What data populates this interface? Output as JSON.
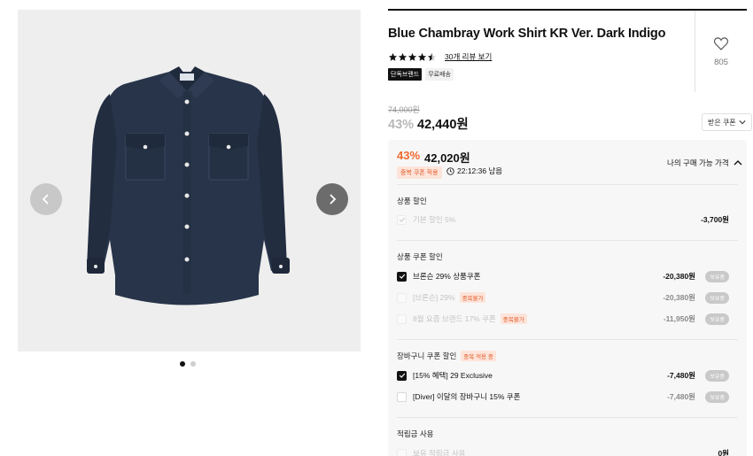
{
  "gallery": {
    "prev_icon": "chevron-left-icon",
    "next_icon": "chevron-right-icon",
    "current_slide": 1,
    "total_slides": 2
  },
  "product": {
    "title": "Blue Chambray Work Shirt KR Ver. Dark Indigo",
    "rating_stars": 4.5,
    "review_link": "30개 리뷰 보기",
    "badges": [
      "단독브랜드",
      "무료배송"
    ],
    "like_count": "805",
    "original_price": "74,000원",
    "discount_pct": "43%",
    "price": "42,440원",
    "coupon_button": "받은 쿠폰"
  },
  "benefits": {
    "best_pct": "43%",
    "best_price": "42,020원",
    "dup_tag": "중복 쿠폰 적용",
    "timer": "22:12:36 남음",
    "my_price_label": "나의 구매 가능 가격",
    "sections": {
      "product_discount": {
        "title": "상품 할인",
        "rows": [
          {
            "label": "기본 할인 5%",
            "value": "-3,700원",
            "checked": true,
            "disabled": true
          }
        ]
      },
      "product_coupon": {
        "title": "상품 쿠폰 할인",
        "rows": [
          {
            "label": "브론슨 29% 상품쿠폰",
            "tag": "",
            "value": "-20,380원",
            "hold": "보유중",
            "checked": true,
            "disabled": false
          },
          {
            "label": "[브론슨] 29%",
            "tag": "중복불가",
            "value": "-20,380원",
            "hold": "보유중",
            "checked": false,
            "disabled": true
          },
          {
            "label": "8월 요즘 브랜드 17% 쿠폰",
            "tag": "중복불가",
            "value": "-11,950원",
            "hold": "보유중",
            "checked": false,
            "disabled": true
          }
        ]
      },
      "cart_coupon": {
        "title": "장바구니 쿠폰 할인",
        "tag": "중복 적용 중",
        "rows": [
          {
            "label": "[15% 혜택] 29 Exclusive",
            "value": "-7,480원",
            "hold": "보유중",
            "checked": true,
            "disabled": false
          },
          {
            "label": "[Diver] 이달의 장바구니 15% 쿠폰",
            "value": "-7,480원",
            "hold": "보유중",
            "checked": false,
            "disabled": false
          }
        ]
      },
      "points": {
        "title": "적립금 사용",
        "rows": [
          {
            "label": "보유 적립금 사용",
            "value": "0원",
            "checked": false,
            "disabled": true
          }
        ]
      }
    }
  },
  "colors": {
    "accent_orange": "#f06a2b",
    "tag_bg": "#fde4da",
    "dark": "#111111",
    "shirt_indigo": "#283449"
  }
}
